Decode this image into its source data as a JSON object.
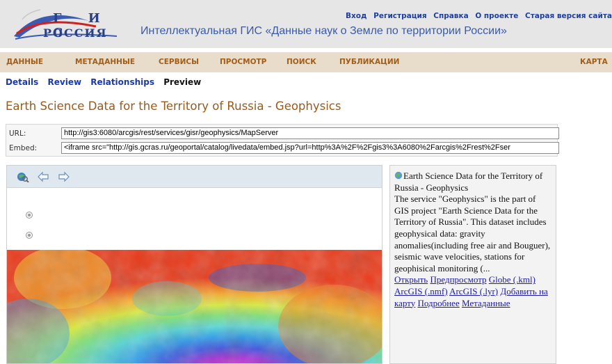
{
  "logo": {
    "top": "Г И С",
    "bottom": "РОССИЯ"
  },
  "header": {
    "title": "Интеллектуальная ГИС «Данные наук о Земле по территории России»",
    "links": [
      "Вход",
      "Регистрация",
      "Справка",
      "О проекте",
      "Старая версия сайта"
    ]
  },
  "nav": {
    "items": [
      "ДАННЫЕ",
      "МЕТАДАННЫЕ",
      "СЕРВИСЫ",
      "ПРОСМОТР",
      "ПОИСК",
      "ПУБЛИКАЦИИ",
      "КАРТА"
    ]
  },
  "tabs": {
    "details": "Details",
    "review": "Review",
    "relationships": "Relationships",
    "preview": "Preview"
  },
  "page": {
    "title": "Earth Science Data for the Territory of Russia - Geophysics"
  },
  "url_box": {
    "url_label": "URL:",
    "url_value": "http://gis3:6080/arcgis/rest/services/gisr/geophysics/MapServer",
    "embed_label": "Embed:",
    "embed_value": "<iframe src=\"http://gis.gcras.ru/geoportal/catalog/livedata/embed.jsp?url=http%3A%2F%2Fgis3%3A6080%2Farcgis%2Frest%2Fser"
  },
  "map": {
    "toolbar_icons": [
      "full-extent-icon",
      "back-arrow-icon",
      "forward-arrow-icon"
    ],
    "zoom_icons": [
      "zoom-in-icon",
      "zoom-out-icon"
    ]
  },
  "info": {
    "title": "Earth Science Data for the Territory of Russia - Geophysics",
    "description": "The service \"Geophysics\" is the part of GIS project \"Earth Science Data for the Territory of Russia\". This dataset includes geophysical data: gravity anomalies(including free air and Bouguer), seismic wave velocities, stations for geophisical monitoring (...",
    "links": [
      "Открыть",
      "Предпросмотр",
      "Globe (.kml)",
      "ArcGIS (.nmf)",
      "ArcGIS (.lyr)",
      "Добавить на карту",
      "Подробнее",
      "Метаданные"
    ]
  }
}
